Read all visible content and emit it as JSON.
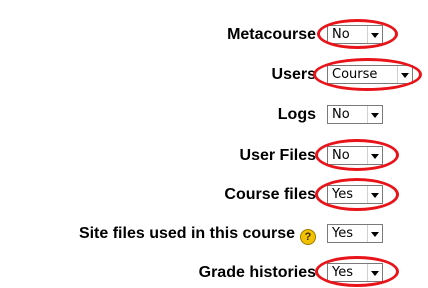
{
  "rows": [
    {
      "label": "Metacourse",
      "value": "No",
      "circled": true
    },
    {
      "label": "Users",
      "value": "Course",
      "circled": true
    },
    {
      "label": "Logs",
      "value": "No",
      "circled": false
    },
    {
      "label": "User Files",
      "value": "No",
      "circled": true
    },
    {
      "label": "Course files",
      "value": "Yes",
      "circled": true
    },
    {
      "label": "Site files used in this course",
      "value": "Yes",
      "circled": false,
      "help_icon": "help-icon"
    },
    {
      "label": "Grade histories",
      "value": "Yes",
      "circled": true
    }
  ],
  "colors": {
    "highlight_ring": "#e8141a",
    "help_icon": "#f2c200"
  }
}
